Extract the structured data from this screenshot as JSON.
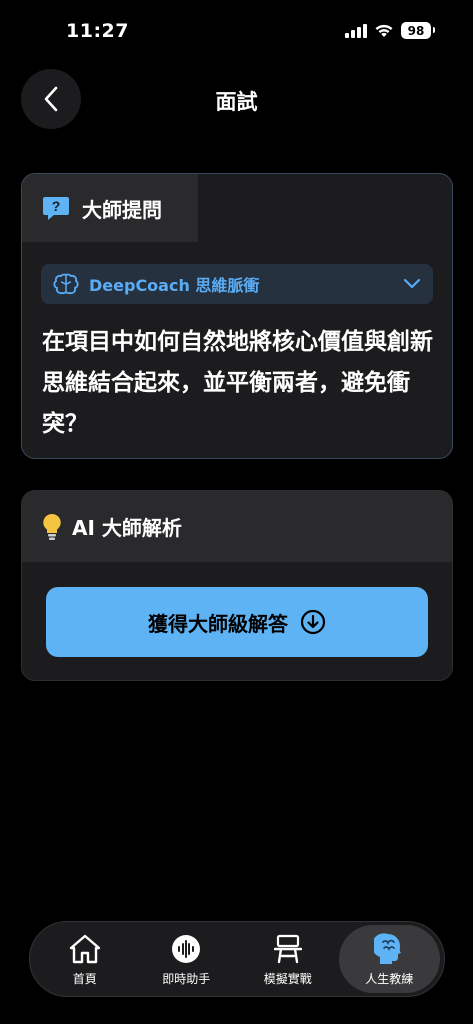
{
  "status": {
    "time": "11:27",
    "battery": "98"
  },
  "header": {
    "title": "面試",
    "back_icon": "chevron-left-icon"
  },
  "question_card": {
    "tab_label": "大師提問",
    "tab_icon": "question-bubble-icon",
    "coach_label": "DeepCoach 思維脈衝",
    "coach_icon": "brain-icon",
    "question": "在項目中如何自然地將核心價值與創新思維結合起來，並平衡兩者，避免衝突？"
  },
  "analysis_card": {
    "title": "AI 大師解析",
    "title_icon": "lightbulb-icon",
    "button_label": "獲得大師級解答",
    "button_icon": "download-circle-icon"
  },
  "tabs": [
    {
      "label": "首頁",
      "icon": "home-icon",
      "active": false
    },
    {
      "label": "即時助手",
      "icon": "voice-wave-icon",
      "active": false
    },
    {
      "label": "模擬實戰",
      "icon": "podium-icon",
      "active": false
    },
    {
      "label": "人生教練",
      "icon": "brain-head-icon",
      "active": true
    }
  ],
  "colors": {
    "accent": "#5eb3f5",
    "coach_text": "#5aacf5",
    "background": "#000000",
    "card": "#1c1c1e"
  }
}
